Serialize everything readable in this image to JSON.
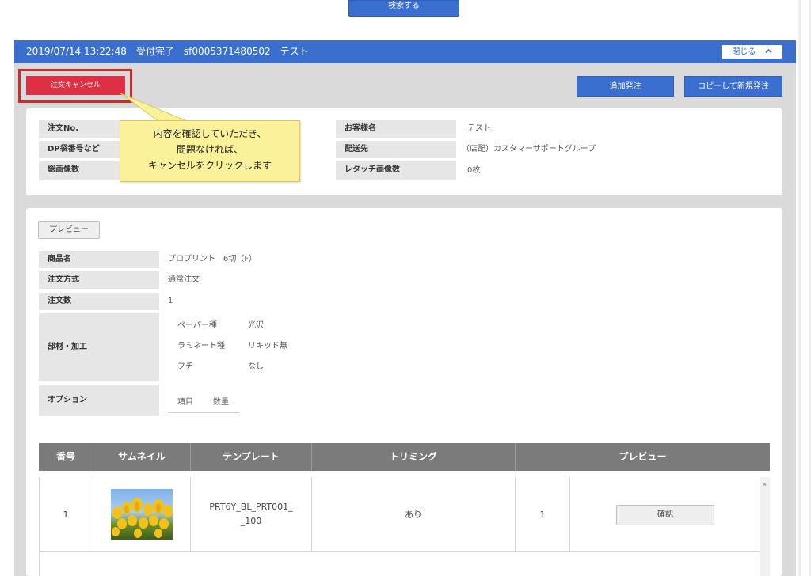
{
  "search_button": "検索する",
  "order": {
    "header_text": "2019/07/14 13:22:48　受付完了　sf0005371480502　テスト",
    "close_label": "閉じる",
    "close_icon": "chevron-up-icon",
    "cancel_label": "注文キャンセル",
    "add_order_label": "追加発注",
    "copy_new_label": "コピーして新規発注"
  },
  "info_left": {
    "order_no_label": "注文No.",
    "dp_label": "DP袋番号など",
    "total_images_label": "総画像数"
  },
  "info_right": {
    "customer_label": "お客様名",
    "customer_value": "テスト",
    "delivery_label": "配送先",
    "delivery_value": "（店配）カスタマーサポートグループ",
    "retouch_label": "レタッチ画像数",
    "retouch_value": "0枚"
  },
  "tooltip": {
    "line1": "内容を確認していただき、",
    "line2": "問題なければ、",
    "line3": "キャンセルをクリックします"
  },
  "product": {
    "preview_label": "プレビュー",
    "name_label": "商品名",
    "name_value": "プロプリント　6切（F）",
    "method_label": "注文方式",
    "method_value": "通常注文",
    "qty_label": "注文数",
    "qty_value": "1",
    "materials_label": "部材・加工",
    "materials": [
      {
        "name": "ペーパー種",
        "value": "光沢"
      },
      {
        "name": "ラミネート種",
        "value": "リキッド無"
      },
      {
        "name": "フチ",
        "value": "なし"
      }
    ],
    "option_label": "オプション",
    "option_item_header": "項目",
    "option_qty_header": "数量"
  },
  "table": {
    "headers": [
      "番号",
      "サムネイル",
      "テンプレート",
      "トリミング",
      "プレビュー"
    ],
    "rows": [
      {
        "no": "1",
        "template_line1": "PRT6Y_BL_PRT001_",
        "template_line2": "_100",
        "trimming": "あり",
        "preview_count": "1",
        "confirm_label": "確認"
      }
    ]
  },
  "colors": {
    "accent": "#3a6fd0",
    "danger": "#dd3044",
    "highlight": "#d12a2a",
    "tooltip": "#fbf19a",
    "table_header": "#7b7b7b"
  }
}
